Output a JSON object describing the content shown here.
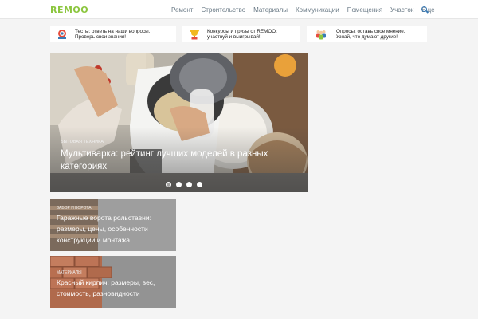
{
  "header": {
    "logo": "REMOO",
    "nav": [
      "Ремонт",
      "Строительство",
      "Материалы",
      "Коммуникации",
      "Помещения",
      "Участок",
      "Еще"
    ]
  },
  "promos": [
    {
      "line1": "Тесты: ответь на наши вопросы.",
      "line2": "Проверь свои знания!",
      "icon": "badge-icon"
    },
    {
      "line1": "Конкурсы и призы от REMOO:",
      "line2": "участвуй и выигрывай!",
      "icon": "trophy-icon"
    },
    {
      "line1": "Опросы: оставь свое мнение.",
      "line2": "Узнай, что думают другие!",
      "icon": "people-icon"
    }
  ],
  "hero": {
    "category": "Бытовая техника",
    "title": "Мультиварка: рейтинг лучших моделей в разных категориях",
    "slides_total": 4,
    "active_slide": 1
  },
  "cards": [
    {
      "category": "Забор и ворота",
      "title": "Гаражные ворота рольставни: размеры, цены, особенности конструкции и монтажа"
    },
    {
      "category": "Материалы",
      "title": "Красный кирпич: размеры, вес, стоимость, разновидности"
    }
  ],
  "colors": {
    "logo": "#8cc63f",
    "nav": "#6a7a86",
    "search": "#3a7ab5"
  }
}
